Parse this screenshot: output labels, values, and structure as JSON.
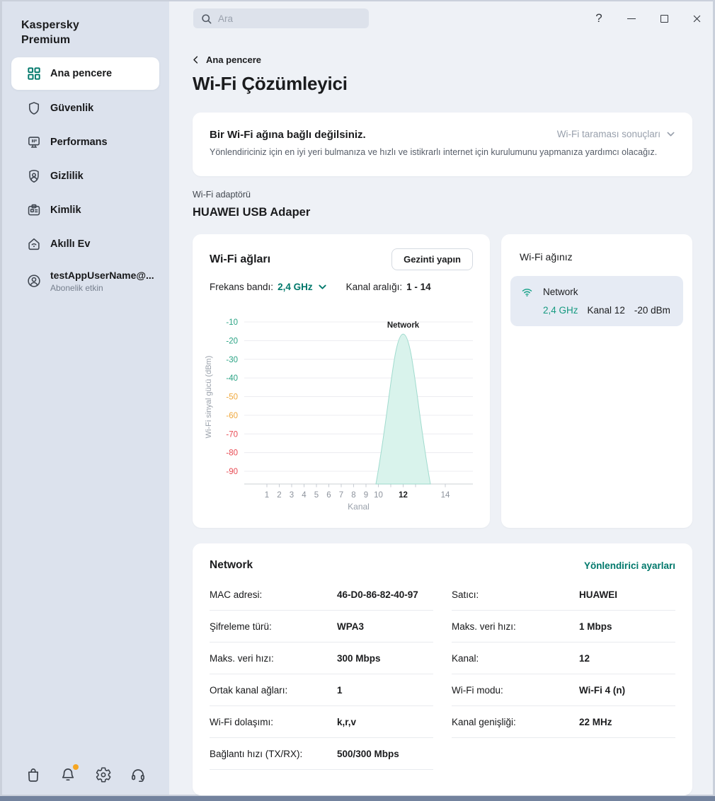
{
  "sidebar": {
    "brand": "Kaspersky Premium",
    "items": [
      {
        "id": "main-window",
        "label": "Ana pencere",
        "icon": "dashboard",
        "active": true
      },
      {
        "id": "security",
        "label": "Güvenlik",
        "icon": "shield"
      },
      {
        "id": "performance",
        "label": "Performans",
        "icon": "monitor"
      },
      {
        "id": "privacy",
        "label": "Gizlilik",
        "icon": "privacy"
      },
      {
        "id": "identity",
        "label": "Kimlik",
        "icon": "id-card"
      },
      {
        "id": "smart-home",
        "label": "Akıllı Ev",
        "icon": "smart-home"
      },
      {
        "id": "account",
        "label": "testAppUserName@...",
        "sublabel": "Abonelik etkin",
        "icon": "account"
      }
    ],
    "footer_icons": [
      {
        "name": "store"
      },
      {
        "name": "notifications",
        "badge": true
      },
      {
        "name": "settings"
      },
      {
        "name": "support"
      }
    ]
  },
  "topbar": {
    "search_placeholder": "Ara",
    "help_glyph": "?"
  },
  "header": {
    "breadcrumb": "Ana pencere",
    "title": "Wi-Fi Çözümleyici"
  },
  "banner": {
    "title": "Bir Wi-Fi ağına bağlı değilsiniz.",
    "dropdown_label": "Wi-Fi taraması sonuçları",
    "description": "Yönlendiriciniz için en iyi yeri bulmanıza ve hızlı ve istikrarlı internet için kurulumunu yapmanıza yardımcı olacağız."
  },
  "adapter": {
    "label": "Wi-Fi adaptörü",
    "name": "HUAWEI USB Adaper"
  },
  "networks_card": {
    "title": "Wi-Fi ağları",
    "survey_button": "Gezinti yapın",
    "band_label": "Frekans bandı:",
    "band_value": "2,4 GHz",
    "range_label": "Kanal aralığı:",
    "range_value": "1 - 14"
  },
  "chart_data": {
    "type": "area",
    "title": "",
    "xlabel": "Kanal",
    "ylabel": "Wi-Fi sinyal gücü (dBm)",
    "x_range_channels": [
      1,
      14
    ],
    "ylim_dbm": [
      -97,
      -10
    ],
    "grid": true,
    "legend": "none",
    "y_ticks": [
      {
        "value": -10,
        "color": "#2aa384"
      },
      {
        "value": -20,
        "color": "#2aa384"
      },
      {
        "value": -30,
        "color": "#2aa384"
      },
      {
        "value": -40,
        "color": "#2aa384"
      },
      {
        "value": -50,
        "color": "#f0a83c"
      },
      {
        "value": -60,
        "color": "#f0a83c"
      },
      {
        "value": -70,
        "color": "#e84a53"
      },
      {
        "value": -80,
        "color": "#e84a53"
      },
      {
        "value": -90,
        "color": "#e84a53"
      }
    ],
    "x_ticks": [
      {
        "label": "1",
        "u": 1
      },
      {
        "label": "2",
        "u": 2
      },
      {
        "label": "3",
        "u": 3
      },
      {
        "label": "4",
        "u": 4
      },
      {
        "label": "5",
        "u": 5
      },
      {
        "label": "6",
        "u": 6
      },
      {
        "label": "7",
        "u": 7
      },
      {
        "label": "8",
        "u": 8
      },
      {
        "label": "9",
        "u": 9
      },
      {
        "label": "10",
        "u": 10
      },
      {
        "label": "12",
        "u": 12,
        "bold": true
      },
      {
        "label": "14",
        "u": 15.4
      }
    ],
    "x_minor_u": [
      1,
      2,
      3,
      4,
      5,
      6,
      7,
      8,
      9,
      10,
      11,
      12,
      13,
      15.4
    ],
    "series": [
      {
        "name": "Network",
        "center_channel": 12,
        "width_mhz": 22,
        "peak_dbm": -16.5,
        "signal_dbm": -20,
        "fill": "#d9f3ec",
        "stroke": "#a0dbce"
      }
    ]
  },
  "your_network_card": {
    "title": "Wi-Fi ağınız",
    "network": {
      "name": "Network",
      "band": "2,4 GHz",
      "channel": "Kanal 12",
      "signal": "-20 dBm"
    }
  },
  "details_card": {
    "title": "Network",
    "router_link": "Yönlendirici ayarları",
    "left_rows": [
      {
        "label": "MAC adresi:",
        "value": "46-D0-86-82-40-97"
      },
      {
        "label": "Şifreleme türü:",
        "value": "WPA3"
      },
      {
        "label": "Maks. veri hızı:",
        "value": "300 Mbps"
      },
      {
        "label": "Ortak kanal ağları:",
        "value": "1"
      },
      {
        "label": "Wi-Fi dolaşımı:",
        "value": "k,r,v"
      },
      {
        "label": "Bağlantı hızı (TX/RX):",
        "value": "500/300 Mbps"
      }
    ],
    "right_rows": [
      {
        "label": "Satıcı:",
        "value": "HUAWEI"
      },
      {
        "label": "Maks. veri hızı:",
        "value": "1 Mbps"
      },
      {
        "label": "Kanal:",
        "value": "12"
      },
      {
        "label": "Wi-Fi modu:",
        "value": "Wi-Fi 4 (n)"
      },
      {
        "label": "Kanal genişliği:",
        "value": "22 MHz"
      }
    ]
  },
  "colors": {
    "accent_teal": "#00786b",
    "chart_good": "#2aa384",
    "chart_mid": "#f0a83c",
    "chart_bad": "#e84a53",
    "notification_dot": "#f5a623",
    "sidebar_bg": "#dce2ed",
    "main_bg": "#eef1f6"
  }
}
